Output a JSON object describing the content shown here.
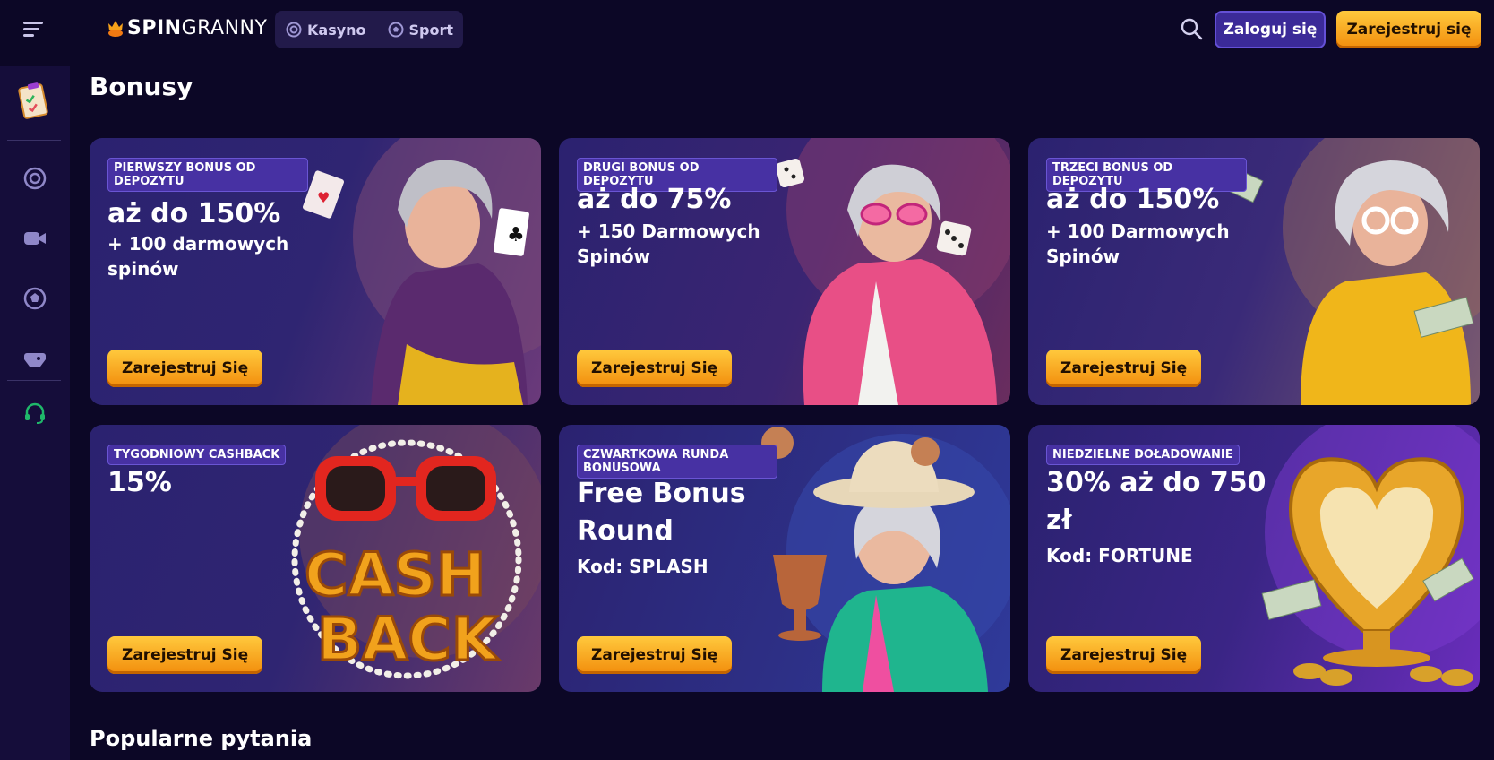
{
  "header": {
    "logo_bold": "SPIN",
    "logo_light": "GRANNY",
    "tabs": [
      {
        "label": "Kasyno",
        "icon": "casino-chip-icon"
      },
      {
        "label": "Sport",
        "icon": "football-icon"
      }
    ],
    "login_label": "Zaloguj się",
    "register_label": "Zarejestruj się"
  },
  "sidebar": {
    "items": [
      {
        "icon": "clipboard-icon"
      },
      {
        "icon": "casino-chip-icon"
      },
      {
        "icon": "live-camera-icon"
      },
      {
        "icon": "football-icon"
      },
      {
        "icon": "gamepad-icon"
      },
      {
        "icon": "headset-icon"
      }
    ]
  },
  "page": {
    "title": "Bonusy",
    "faq_title": "Popularne pytania"
  },
  "cards": [
    {
      "badge": "Pierwszy bonus od depozytu",
      "headline": "aż do 150%",
      "sub": [
        "+ 100 darmowych",
        "spinów"
      ],
      "cta": "Zarejestruj Się"
    },
    {
      "badge": "Drugi bonus od depozytu",
      "headline": "aż do 75%",
      "sub": [
        "+ 150 Darmowych",
        "Spinów"
      ],
      "cta": "Zarejestruj Się"
    },
    {
      "badge": "Trzeci bonus od depozytu",
      "headline": "aż do 150%",
      "sub": [
        "+ 100 Darmowych",
        "Spinów"
      ],
      "cta": "Zarejestruj Się"
    },
    {
      "badge": "Tygodniowy cashback",
      "headline": "15%",
      "sub": [],
      "cta": "Zarejestruj Się"
    },
    {
      "badge": "Czwartkowa runda bonusowa",
      "headline": "Free Bonus",
      "headline2": "Round",
      "sub": [
        "Kod: SPLASH"
      ],
      "cta": "Zarejestruj Się"
    },
    {
      "badge": "Niedzielne doładowanie",
      "headline": "30% aż do 750",
      "headline2": "zł",
      "sub": [
        "Kod: FORTUNE"
      ],
      "cta": "Zarejestruj Się"
    }
  ],
  "colors": {
    "background": "#0c0726",
    "sidebar": "#150d3a",
    "accent_orange": "#f6a21a",
    "login_purple": "#3b2a98"
  }
}
